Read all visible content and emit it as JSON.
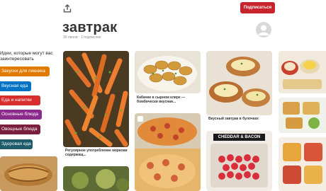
{
  "header": {
    "subscribe_label": "Подписаться",
    "board_title": "завтрак",
    "board_meta": "30 пинов · 1 подписчик"
  },
  "left_panel": {
    "heading": "Идеи, которые могут вас заинтересовать",
    "tags": [
      {
        "label": "Закуски для пикника",
        "color": "#e07b00"
      },
      {
        "label": "Вкусная еда",
        "color": "#0073c6"
      },
      {
        "label": "Еда и напитки",
        "color": "#d82d2d"
      },
      {
        "label": "Основные блюда",
        "color": "#8c2a8c"
      },
      {
        "label": "Овощные блюда",
        "color": "#7a1f3d"
      },
      {
        "label": "Здоровая еда",
        "color": "#1e5c6b"
      }
    ]
  },
  "pins": {
    "carrots_caption": "Регулярное употребление моркови содержащ...",
    "kabachki_caption": "Кабачки в сырном кляре — бомбически вкусная...",
    "bun_caption": "Вкусный завтрак в булочках",
    "banner_text": "CHEDDAR & BACON"
  },
  "colors": {
    "accent": "#c8232c"
  }
}
